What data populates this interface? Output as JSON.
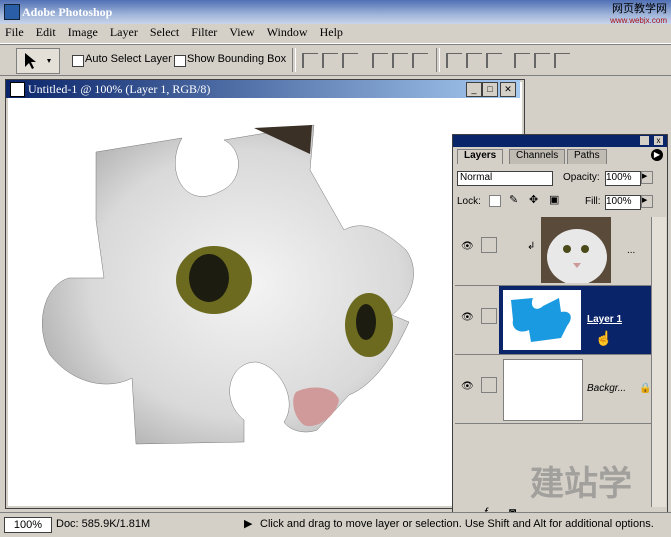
{
  "app": {
    "title": "Adobe Photoshop",
    "watermark": "网页教学网",
    "watermark_sub": "www.webjx.com"
  },
  "menu": [
    "File",
    "Edit",
    "Image",
    "Layer",
    "Select",
    "Filter",
    "View",
    "Window",
    "Help"
  ],
  "options": {
    "auto_select": "Auto Select Layer",
    "show_bounding": "Show Bounding Box"
  },
  "document": {
    "title": "Untitled-1 @ 100% (Layer 1, RGB/8)"
  },
  "layers_panel": {
    "tabs": [
      "Layers",
      "Channels",
      "Paths"
    ],
    "blend_mode": "Normal",
    "opacity_label": "Opacity:",
    "opacity_value": "100%",
    "lock_label": "Lock:",
    "fill_label": "Fill:",
    "fill_value": "100%",
    "layers": [
      {
        "name": "..."
      },
      {
        "name": "Layer 1"
      },
      {
        "name": "Backgr..."
      }
    ]
  },
  "status": {
    "zoom": "100%",
    "doc": "Doc: 585.9K/1.81M",
    "hint": "Click and drag to move layer or selection. Use Shift and Alt for additional options."
  },
  "watermark_bottom": "建站学"
}
